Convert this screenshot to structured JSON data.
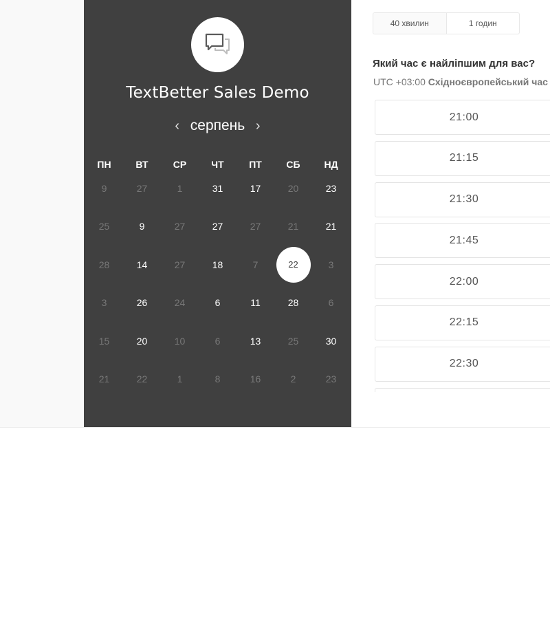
{
  "event": {
    "title": "TextBetter Sales Demo",
    "logo_icon": "chat-bubbles-icon"
  },
  "calendar": {
    "month": "серпень",
    "prev_icon": "‹",
    "next_icon": "›",
    "weekdays": [
      "ПН",
      "ВТ",
      "СР",
      "ЧТ",
      "ПТ",
      "СБ",
      "НД"
    ],
    "weeks": [
      [
        {
          "d": "9",
          "s": "muted"
        },
        {
          "d": "27",
          "s": "muted"
        },
        {
          "d": "1",
          "s": "muted"
        },
        {
          "d": "31",
          "s": "active"
        },
        {
          "d": "17",
          "s": "active"
        },
        {
          "d": "20",
          "s": "muted"
        },
        {
          "d": "23",
          "s": "active"
        }
      ],
      [
        {
          "d": "25",
          "s": "muted"
        },
        {
          "d": "9",
          "s": "active"
        },
        {
          "d": "27",
          "s": "muted"
        },
        {
          "d": "27",
          "s": "active"
        },
        {
          "d": "27",
          "s": "muted"
        },
        {
          "d": "21",
          "s": "muted"
        },
        {
          "d": "21",
          "s": "active"
        }
      ],
      [
        {
          "d": "28",
          "s": "muted"
        },
        {
          "d": "14",
          "s": "active"
        },
        {
          "d": "27",
          "s": "muted"
        },
        {
          "d": "18",
          "s": "active"
        },
        {
          "d": "7",
          "s": "muted"
        },
        {
          "d": "22",
          "s": "selected"
        },
        {
          "d": "3",
          "s": "muted"
        }
      ],
      [
        {
          "d": "3",
          "s": "muted"
        },
        {
          "d": "26",
          "s": "active"
        },
        {
          "d": "24",
          "s": "muted"
        },
        {
          "d": "6",
          "s": "active"
        },
        {
          "d": "11",
          "s": "active"
        },
        {
          "d": "28",
          "s": "active"
        },
        {
          "d": "6",
          "s": "muted"
        }
      ],
      [
        {
          "d": "15",
          "s": "muted"
        },
        {
          "d": "20",
          "s": "active"
        },
        {
          "d": "10",
          "s": "muted"
        },
        {
          "d": "6",
          "s": "muted"
        },
        {
          "d": "13",
          "s": "active"
        },
        {
          "d": "25",
          "s": "muted"
        },
        {
          "d": "30",
          "s": "active"
        }
      ],
      [
        {
          "d": "21",
          "s": "muted"
        },
        {
          "d": "22",
          "s": "muted"
        },
        {
          "d": "1",
          "s": "muted"
        },
        {
          "d": "8",
          "s": "muted"
        },
        {
          "d": "16",
          "s": "muted"
        },
        {
          "d": "2",
          "s": "muted"
        },
        {
          "d": "23",
          "s": "muted"
        }
      ]
    ]
  },
  "durations": [
    "40 хвилин",
    "1 годин"
  ],
  "times": {
    "question": "Який час є найліпшим для вас?",
    "tz_offset": "UTC +03:00",
    "tz_name": "Східноєвропейський час",
    "slots": [
      "21:00",
      "21:15",
      "21:30",
      "21:45",
      "22:00",
      "22:15",
      "22:30"
    ]
  },
  "colors": {
    "panel": "#404040",
    "muted_day": "#787878",
    "selected_bg": "#ffffff"
  }
}
